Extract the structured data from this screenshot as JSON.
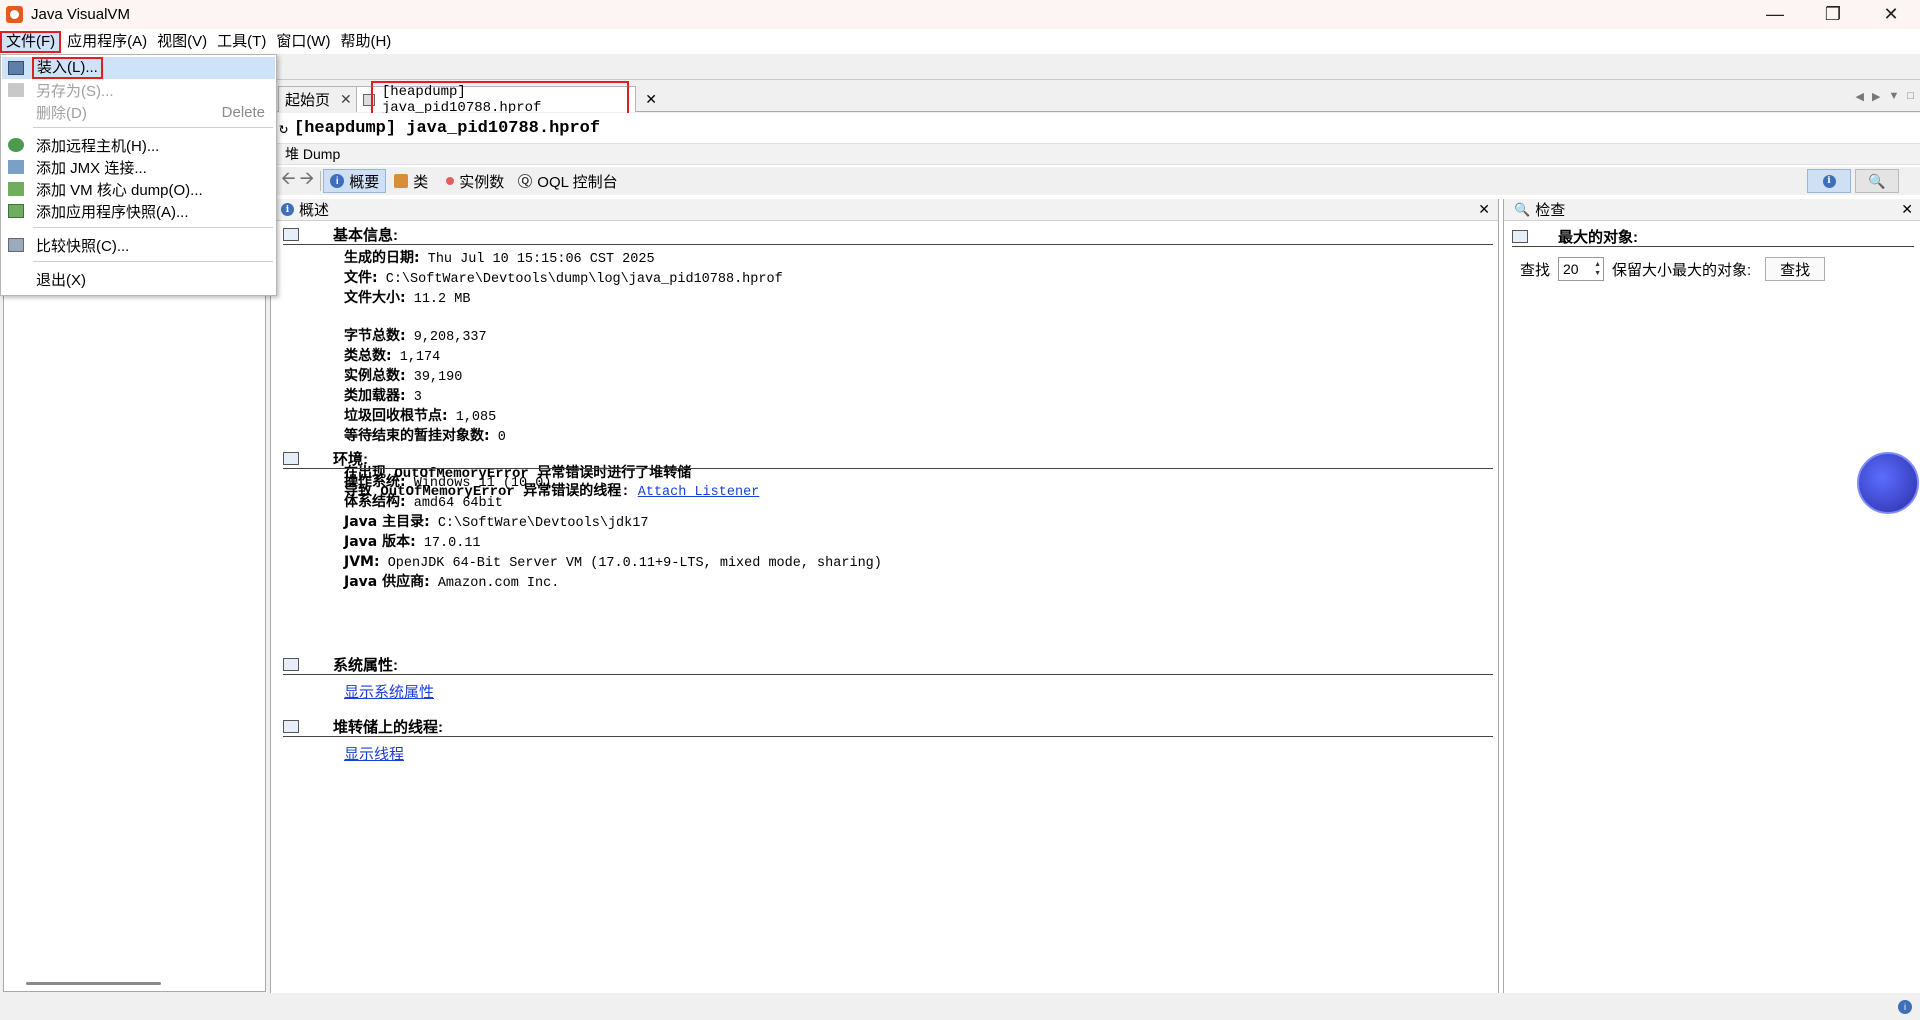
{
  "window": {
    "title": "Java VisualVM"
  },
  "menubar": {
    "items": [
      "文件(F)",
      "应用程序(A)",
      "视图(V)",
      "工具(T)",
      "窗口(W)",
      "帮助(H)"
    ]
  },
  "file_menu": {
    "load": "装入(L)...",
    "save_as": "另存为(S)...",
    "delete": "删除(D)",
    "delete_shortcut": "Delete",
    "add_remote_host": "添加远程主机(H)...",
    "add_jmx": "添加 JMX 连接...",
    "add_vm_core": "添加 VM 核心 dump(O)...",
    "add_snapshot": "添加应用程序快照(A)...",
    "compare_snapshots": "比较快照(C)...",
    "exit": "退出(X)"
  },
  "tabs": {
    "start": "起始页",
    "heap": "[heapdump] java_pid10788.hprof"
  },
  "doc": {
    "header": "[heapdump] java_pid10788.hprof",
    "subheader": "堆 Dump"
  },
  "viewbar": {
    "summary": "概要",
    "classes": "类",
    "instances": "实例数",
    "oql": "OQL 控制台"
  },
  "overview": {
    "panel_title": "概述",
    "basic_title": "基本信息:",
    "basic": [
      {
        "k": "生成的日期:",
        "v": "Thu Jul 10 15:15:06 CST 2025"
      },
      {
        "k": "文件:",
        "v": "C:\\SoftWare\\Devtools\\dump\\log\\java_pid10788.hprof"
      },
      {
        "k": "文件大小:",
        "v": "11.2 MB"
      }
    ],
    "counts": [
      {
        "k": "字节总数:",
        "v": "9,208,337"
      },
      {
        "k": "类总数:",
        "v": "1,174"
      },
      {
        "k": "实例总数:",
        "v": "39,190"
      },
      {
        "k": "类加载器:",
        "v": "3"
      },
      {
        "k": "垃圾回收根节点:",
        "v": "1,085"
      },
      {
        "k": "等待结束的暂挂对象数:",
        "v": "0"
      }
    ],
    "oom_line1": "在出现 OutOfMemoryError 异常错误时进行了堆转储",
    "oom_line2_prefix": "导致 OutOfMemoryError 异常错误的线程:",
    "oom_thread_link": "Attach Listener",
    "env_title": "环境:",
    "env": [
      {
        "k": "操作系统:",
        "v": "Windows 11 (10.0)"
      },
      {
        "k": "体系结构:",
        "v": "amd64 64bit"
      },
      {
        "k": "Java 主目录:",
        "v": "C:\\SoftWare\\Devtools\\jdk17"
      },
      {
        "k": "Java 版本:",
        "v": "17.0.11"
      },
      {
        "k": "JVM:",
        "v": "OpenJDK 64-Bit Server VM (17.0.11+9-LTS, mixed mode, sharing)"
      },
      {
        "k": "Java 供应商:",
        "v": "Amazon.com Inc."
      }
    ],
    "sysprops_title": "系统属性:",
    "sysprops_link": "显示系统属性",
    "threads_title": "堆转储上的线程:",
    "threads_link": "显示线程"
  },
  "inspect": {
    "panel_title": "检查",
    "section_title": "最大的对象:",
    "find_label": "查找",
    "count_value": "20",
    "retained_label": "保留大小最大的对象:",
    "find_button": "查找"
  },
  "colors": {
    "highlight": "#e02020",
    "link": "#1a3fd8",
    "selection": "#cfe3f8"
  }
}
